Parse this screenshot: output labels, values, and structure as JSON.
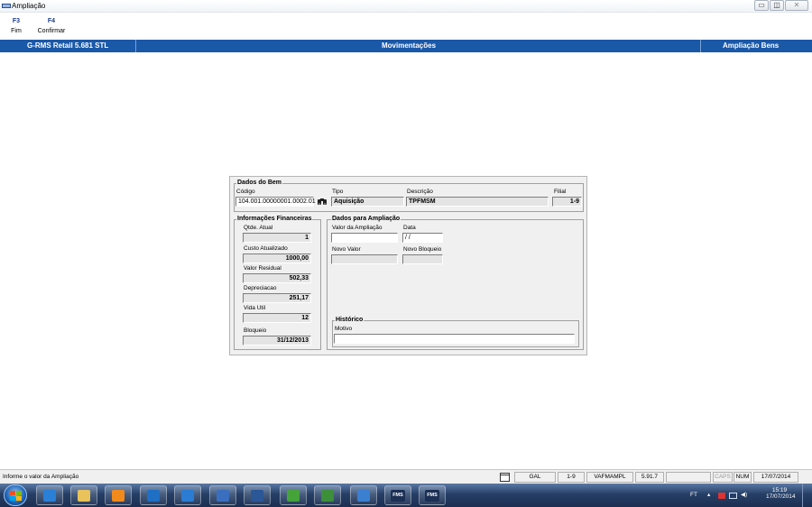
{
  "window": {
    "title": "Ampliação",
    "minimize": "▭",
    "maximize": "◫",
    "close": "✕"
  },
  "function_keys": [
    {
      "key": "F3",
      "label": "Fim"
    },
    {
      "key": "F4",
      "label": "Confirmar"
    }
  ],
  "header": {
    "app_name": "G-RMS Retail 5.681 STL",
    "module": "Movimentações",
    "screen": "Ampliação Bens"
  },
  "dados_do_bem": {
    "title": "Dados do Bem",
    "codigo_label": "Código",
    "codigo_value": "104.001.00000001.0002.01",
    "search_icon": "binoculars-icon",
    "tipo_label": "Tipo",
    "tipo_value": "Aquisição",
    "descricao_label": "Descrição",
    "descricao_value": "TPFMSM",
    "filial_label": "Filial",
    "filial_value": "1-9"
  },
  "info_financeiras": {
    "title": "Informações Financeiras",
    "qtde_label": "Qtde. Atual",
    "qtde_value": "1",
    "custo_label": "Custo Atualizado",
    "custo_value": "1000,00",
    "residual_label": "Valor Residual",
    "residual_value": "502,33",
    "deprec_label": "Depreciacao",
    "deprec_value": "251,17",
    "vida_label": "Vida Util",
    "vida_value": "12",
    "bloqueio_label": "Bloqueio",
    "bloqueio_value": "31/12/2013"
  },
  "dados_ampliacao": {
    "title": "Dados para Ampliação",
    "valor_label": "Valor da Ampliação",
    "valor_value": "",
    "data_label": "Data",
    "data_value": " /  /",
    "novo_valor_label": "Novo Valor",
    "novo_valor_value": "",
    "novo_bloqueio_label": "Novo Bloqueio",
    "novo_bloqueio_value": ""
  },
  "historico": {
    "title": "Histórico",
    "motivo_label": "Motivo",
    "motivo_value": ""
  },
  "statusbar": {
    "message": "Informe o valor da Ampliação",
    "cells": [
      "GAL",
      "1-9",
      "VAFMAMPL",
      "5.91.7",
      "",
      "CAPS",
      "NUM",
      "17/07/2014"
    ]
  },
  "taskbar": {
    "buttons": [
      {
        "icon": "ie-icon",
        "color": "#2a7fd6"
      },
      {
        "icon": "folder-icon",
        "color": "#e8c25a"
      },
      {
        "icon": "media-player-icon",
        "color": "#f08a1c"
      },
      {
        "icon": "outlook-icon",
        "color": "#1f6fc5"
      },
      {
        "icon": "lync-icon",
        "color": "#2b7cd3"
      },
      {
        "icon": "infinity-icon",
        "color": "#3a6fc0"
      },
      {
        "icon": "word-icon",
        "color": "#2b5797"
      },
      {
        "icon": "app-green-icon",
        "color": "#45a33a"
      },
      {
        "icon": "app-stack-icon",
        "color": "#3d8f3a"
      },
      {
        "icon": "globe-icon",
        "color": "#3b7fd0"
      },
      {
        "icon": "fms-icon",
        "label": "FMS",
        "color": "#1c2f55"
      },
      {
        "icon": "fms-icon",
        "label": "FMS",
        "color": "#1c2f55"
      }
    ],
    "tray_lang": "FT",
    "time": "15:19",
    "date": "17/07/2014"
  },
  "colors": {
    "header_bg": "#1a58a8",
    "taskbar_bg": "#263f66"
  }
}
